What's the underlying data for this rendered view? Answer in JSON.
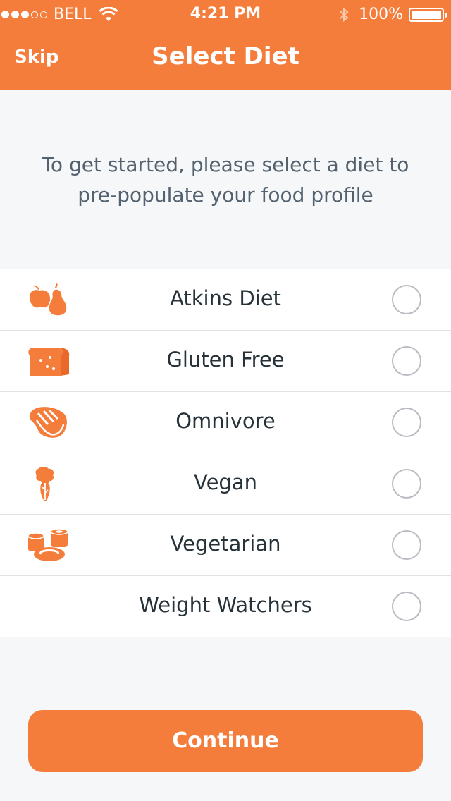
{
  "status_bar": {
    "carrier": "BELL",
    "time": "4:21 PM",
    "battery": "100%"
  },
  "header": {
    "skip_label": "Skip",
    "title": "Select Diet"
  },
  "intro": "To get started, please select a diet to pre-populate your food profile",
  "diets": [
    {
      "label": "Atkins Diet",
      "icon": "fruit-icon",
      "selected": false
    },
    {
      "label": "Gluten Free",
      "icon": "bread-icon",
      "selected": false
    },
    {
      "label": "Omnivore",
      "icon": "steak-icon",
      "selected": false
    },
    {
      "label": "Vegan",
      "icon": "vegetable-icon",
      "selected": false
    },
    {
      "label": "Vegetarian",
      "icon": "sushi-icon",
      "selected": false
    },
    {
      "label": "Weight Watchers",
      "icon": null,
      "selected": false
    }
  ],
  "continue_label": "Continue",
  "colors": {
    "accent": "#f47d3b",
    "text": "#263238",
    "muted_text": "#546270"
  }
}
